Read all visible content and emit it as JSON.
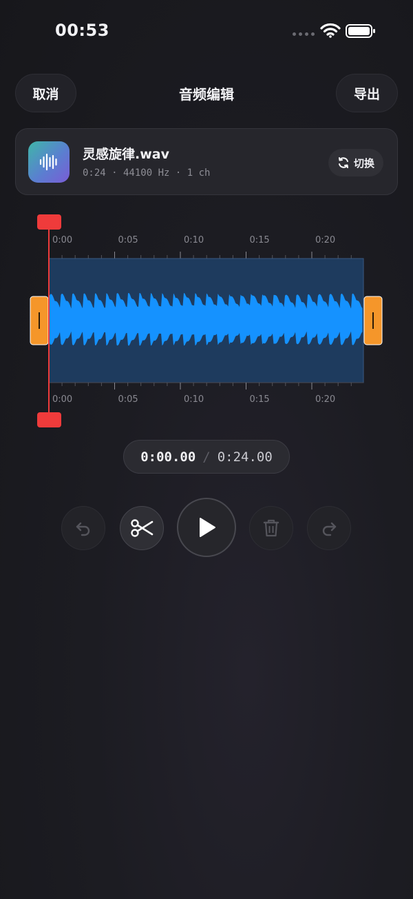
{
  "status_bar": {
    "time": "00:53"
  },
  "header": {
    "cancel_label": "取消",
    "title": "音频编辑",
    "export_label": "导出"
  },
  "file": {
    "name": "灵感旋律.wav",
    "meta": "0:24 · 44100 Hz · 1 ch",
    "switch_label": "切换"
  },
  "timeline": {
    "ticks": [
      "0:00",
      "0:05",
      "0:10",
      "0:15",
      "0:20"
    ]
  },
  "playback": {
    "current": "0:00.00",
    "separator": "/",
    "total": "0:24.00"
  },
  "colors": {
    "waveform": "#1592ff",
    "selection": "#1e3b5e",
    "playhead": "#ef3b3b",
    "handle": "#f5962a"
  },
  "icons": {
    "undo": "undo-icon",
    "cut": "scissors-icon",
    "play": "play-icon",
    "delete": "trash-icon",
    "redo": "redo-icon",
    "file": "audio-wave-icon",
    "switch": "refresh-icon"
  }
}
